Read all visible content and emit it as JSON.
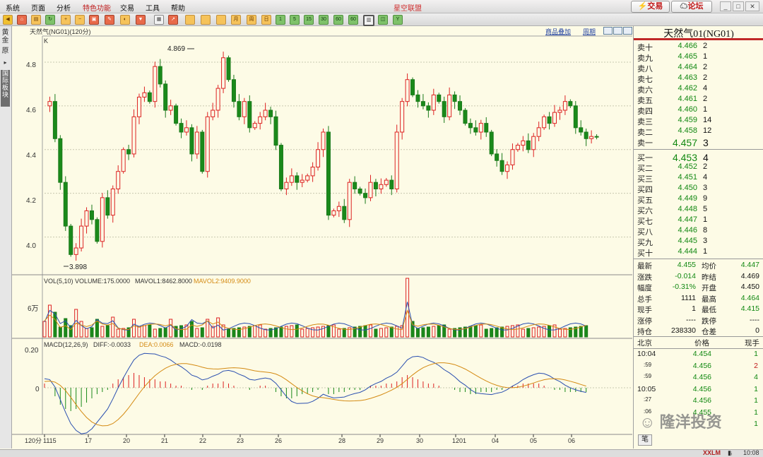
{
  "menu": {
    "items": [
      "系统",
      "页面",
      "分析",
      "特色功能",
      "交易",
      "工具",
      "帮助"
    ],
    "title": "星空联盟",
    "trade_button": "交易",
    "forum_button": "论坛"
  },
  "toolbar": {
    "period_labels": [
      "1",
      "5",
      "15",
      "30",
      "60",
      "日",
      "周",
      "月"
    ]
  },
  "left_tabs": {
    "tab1": "黄金",
    "tab2": "原",
    "tab3": "国际板块"
  },
  "chart": {
    "header": "天然气(NG01)(120分)",
    "k_label": "K",
    "overlay_link": "商品叠加",
    "period_link": "周期",
    "price_axis": [
      "4.8",
      "4.6",
      "4.4",
      "4.2",
      "4.0"
    ],
    "high_annotation": "4.869",
    "low_annotation": "3.898",
    "volume_header": {
      "prefix": "VOL(5,10) VOLUME:175.0000",
      "mavol1": "MAVOL1:8462.8000",
      "mavol2": "MAVOL2:9409.9000"
    },
    "volume_axis": "6万",
    "macd_header": {
      "prefix": "MACD(12,26,9)",
      "diff": "DIFF:-0.0033",
      "dea": "DEA:0.0066",
      "macd": "MACD:-0.0198"
    },
    "macd_axis": [
      "0.20",
      "0"
    ],
    "bottom_left_label": "120分",
    "x_ticks": [
      "1115",
      "17",
      "20",
      "21",
      "22",
      "23",
      "26",
      "28",
      "29",
      "30",
      "1201",
      "04",
      "05",
      "06"
    ],
    "chart_data": {
      "type": "candlestick",
      "title": "天然气(NG01)(120分)",
      "ylim": [
        3.85,
        4.9
      ],
      "annotations": [
        {
          "label": "4.869",
          "value": 4.869
        },
        {
          "label": "3.898",
          "value": 3.898
        }
      ],
      "price_path": [
        4.6,
        4.62,
        4.45,
        4.25,
        4.05,
        3.92,
        3.95,
        4.05,
        4.12,
        4.08,
        3.98,
        4.18,
        4.1,
        4.22,
        4.3,
        4.4,
        4.38,
        4.55,
        4.64,
        4.66,
        4.62,
        4.78,
        4.7,
        4.58,
        4.6,
        4.52,
        4.48,
        4.5,
        4.38,
        4.48,
        4.3,
        4.55,
        4.58,
        4.68,
        4.82,
        4.72,
        4.62,
        4.55,
        4.62,
        4.5,
        4.52,
        4.55,
        4.58,
        4.55,
        4.42,
        4.22,
        4.25,
        4.28,
        4.25,
        4.26,
        4.28,
        4.32,
        4.4,
        4.48,
        4.1,
        4.12,
        4.14,
        4.08,
        4.25,
        4.22,
        4.2,
        4.18,
        4.25,
        4.22,
        4.24,
        4.26,
        4.22,
        4.48,
        4.62,
        4.72,
        4.65,
        4.62,
        4.6,
        4.58,
        4.65,
        4.62,
        4.55,
        4.65,
        4.62,
        4.58,
        4.52,
        4.5,
        4.48,
        4.52,
        4.48,
        4.38,
        4.35,
        4.3,
        4.33,
        4.4,
        4.42,
        4.44,
        4.4,
        4.46,
        4.5,
        4.55,
        4.52,
        4.57,
        4.58,
        4.62,
        4.6,
        4.5,
        4.48,
        4.45,
        4.46,
        4.457
      ],
      "volume": [
        2,
        4,
        3,
        1,
        2,
        1,
        3,
        2,
        1,
        1,
        2,
        1,
        1,
        2,
        1,
        1,
        1,
        2,
        1,
        1,
        1,
        1,
        1,
        1,
        2,
        1,
        1,
        1,
        2,
        1,
        1,
        2,
        1,
        2,
        1,
        1,
        1,
        1,
        1,
        1,
        1,
        1,
        1,
        1,
        1,
        1,
        1,
        1,
        1,
        1,
        1,
        1,
        1,
        1,
        1,
        1,
        1,
        1,
        1,
        1,
        1,
        1,
        1,
        1,
        1,
        1,
        1,
        1,
        1,
        7,
        2,
        1,
        1,
        1,
        1,
        1,
        1,
        1,
        1,
        1,
        1,
        1,
        1,
        1,
        1,
        1,
        1,
        1,
        1,
        1,
        1,
        1,
        1,
        1,
        1,
        1,
        1,
        1,
        1,
        1,
        1,
        1,
        1,
        1
      ],
      "macd_hist": [
        0.02,
        0.0,
        -0.04,
        -0.08,
        -0.1,
        -0.11,
        -0.1,
        -0.09,
        -0.07,
        -0.05,
        -0.03,
        -0.02,
        -0.01,
        0.02,
        0.04,
        0.05,
        0.06,
        0.07,
        0.06,
        0.05,
        0.04,
        0.04,
        0.03,
        0.03,
        0.02,
        0.01,
        0.01,
        0.0,
        -0.01,
        0.0,
        -0.01,
        0.01,
        0.02,
        0.02,
        0.03,
        0.02,
        0.01,
        0.0,
        0.0,
        -0.01,
        0.0,
        0.01,
        0.01,
        0.0,
        -0.02,
        -0.04,
        -0.05,
        -0.05,
        -0.04,
        -0.03,
        -0.03,
        -0.02,
        -0.01,
        0.0,
        -0.03,
        -0.03,
        -0.02,
        -0.02,
        -0.01,
        -0.01,
        -0.01,
        0.0,
        0.01,
        0.01,
        0.01,
        0.02,
        0.02,
        0.03,
        0.05,
        0.06,
        0.05,
        0.04,
        0.03,
        0.02,
        0.02,
        0.01,
        0.0,
        0.0,
        -0.01,
        -0.02,
        -0.02,
        -0.03,
        -0.03,
        -0.02,
        -0.02,
        -0.02,
        -0.01,
        -0.01,
        0.0,
        0.01,
        0.01,
        0.02,
        0.02,
        0.02,
        0.02,
        0.01,
        0.0,
        -0.01,
        -0.01,
        -0.02,
        -0.02,
        -0.02,
        -0.02,
        -0.02
      ]
    }
  },
  "quote": {
    "name": "天然气01(NG01)",
    "asks": [
      {
        "label": "卖十",
        "price": "4.466",
        "vol": "2"
      },
      {
        "label": "卖九",
        "price": "4.465",
        "vol": "1"
      },
      {
        "label": "卖八",
        "price": "4.464",
        "vol": "2"
      },
      {
        "label": "卖七",
        "price": "4.463",
        "vol": "2"
      },
      {
        "label": "卖六",
        "price": "4.462",
        "vol": "4"
      },
      {
        "label": "卖五",
        "price": "4.461",
        "vol": "2"
      },
      {
        "label": "卖四",
        "price": "4.460",
        "vol": "1"
      },
      {
        "label": "卖三",
        "price": "4.459",
        "vol": "14"
      },
      {
        "label": "卖二",
        "price": "4.458",
        "vol": "12"
      },
      {
        "label": "卖一",
        "price": "4.457",
        "vol": "3"
      }
    ],
    "bids": [
      {
        "label": "买一",
        "price": "4.453",
        "vol": "4"
      },
      {
        "label": "买二",
        "price": "4.452",
        "vol": "2"
      },
      {
        "label": "买三",
        "price": "4.451",
        "vol": "4"
      },
      {
        "label": "买四",
        "price": "4.450",
        "vol": "3"
      },
      {
        "label": "买五",
        "price": "4.449",
        "vol": "9"
      },
      {
        "label": "买六",
        "price": "4.448",
        "vol": "5"
      },
      {
        "label": "买七",
        "price": "4.447",
        "vol": "1"
      },
      {
        "label": "买八",
        "price": "4.446",
        "vol": "8"
      },
      {
        "label": "买九",
        "price": "4.445",
        "vol": "3"
      },
      {
        "label": "买十",
        "price": "4.444",
        "vol": "1"
      }
    ],
    "stats": [
      {
        "l1": "最新",
        "v1": "4.455",
        "l2": "均价",
        "v2": "4.447"
      },
      {
        "l1": "涨跌",
        "v1": "-0.014",
        "l2": "昨结",
        "v2": "4.469"
      },
      {
        "l1": "幅度",
        "v1": "-0.31%",
        "l2": "开盘",
        "v2": "4.450"
      },
      {
        "l1": "总手",
        "v1": "1111",
        "l2": "最高",
        "v2": "4.464"
      },
      {
        "l1": "现手",
        "v1": "1",
        "l2": "最低",
        "v2": "4.415"
      },
      {
        "l1": "涨停",
        "v1": "----",
        "l2": "跌停",
        "v2": "----"
      },
      {
        "l1": "持仓",
        "v1": "238330",
        "l2": "仓差",
        "v2": "0"
      }
    ],
    "ticks_header": {
      "c1": "北京",
      "c2": "价格",
      "c3": "现手"
    },
    "ticks": [
      {
        "time": "10:04",
        "price": "4.454",
        "vol": "1"
      },
      {
        "time": ":59",
        "price": "4.456",
        "vol": "2"
      },
      {
        "time": ":59",
        "price": "4.456",
        "vol": "4"
      },
      {
        "time": "10:05",
        "price": "4.456",
        "vol": "1"
      },
      {
        "time": ":27",
        "price": "4.456",
        "vol": "1"
      },
      {
        "time": ":06",
        "price": "4.455",
        "vol": "1"
      },
      {
        "time": "",
        "price": "",
        "vol": "1"
      }
    ],
    "bottom_tab": "笔"
  },
  "watermark": "隆洋投资",
  "status": {
    "brand": "XXLM",
    "time": "10:08"
  }
}
